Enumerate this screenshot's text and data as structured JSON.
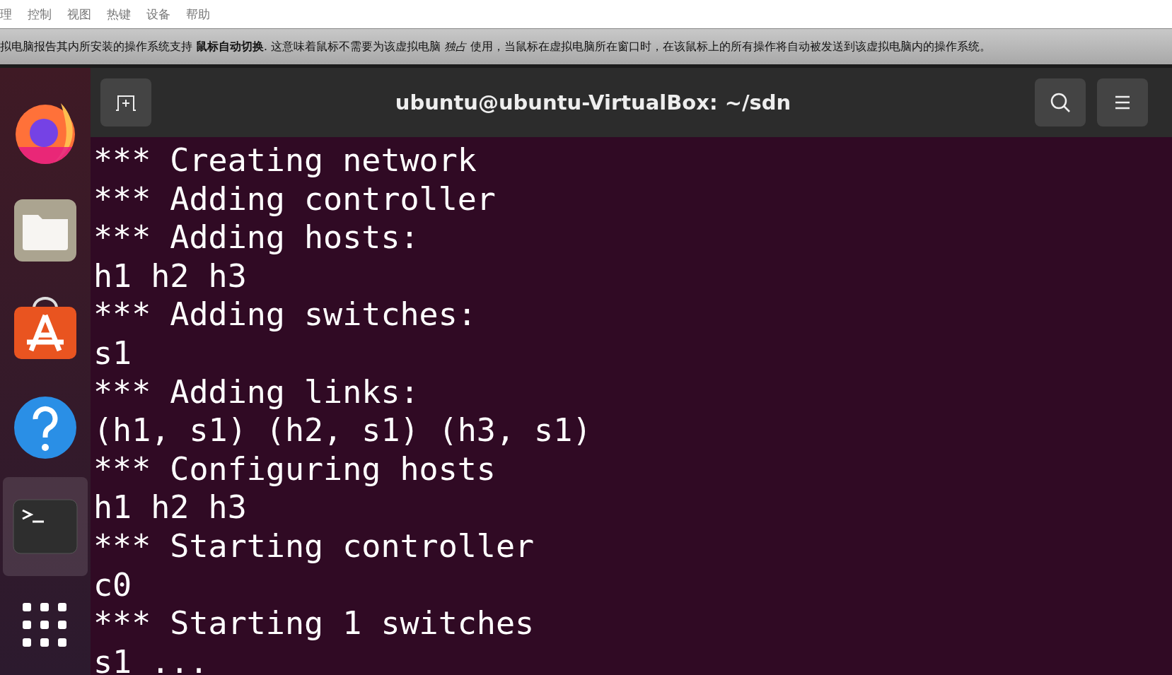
{
  "menu": [
    "理",
    "控制",
    "视图",
    "热键",
    "设备",
    "帮助"
  ],
  "notice": "拟电脑报告其内所安装的操作系统支持 **鼠标自动切换**. 这意味着鼠标不需要为该虚拟电脑 *独占* 使用，当鼠标在虚拟电脑所在窗口时，在该鼠标上的所有操作将自动被发送到该虚拟电脑内的操作系统。",
  "dock": [
    {
      "kind": "browser",
      "selected": false
    },
    {
      "kind": "files",
      "selected": false
    },
    {
      "kind": "store",
      "selected": false
    },
    {
      "kind": "help",
      "selected": false
    },
    {
      "kind": "terminal",
      "selected": true
    },
    {
      "kind": "apps",
      "selected": false
    }
  ],
  "window": {
    "title": "ubuntu@ubuntu-VirtualBox: ~/sdn"
  },
  "terminal_lines": [
    "*** Creating network",
    "*** Adding controller",
    "*** Adding hosts:",
    "h1 h2 h3",
    "*** Adding switches:",
    "s1",
    "*** Adding links:",
    "(h1, s1) (h2, s1) (h3, s1)",
    "*** Configuring hosts",
    "h1 h2 h3",
    "*** Starting controller",
    "c0",
    "*** Starting 1 switches",
    "s1 ..."
  ]
}
